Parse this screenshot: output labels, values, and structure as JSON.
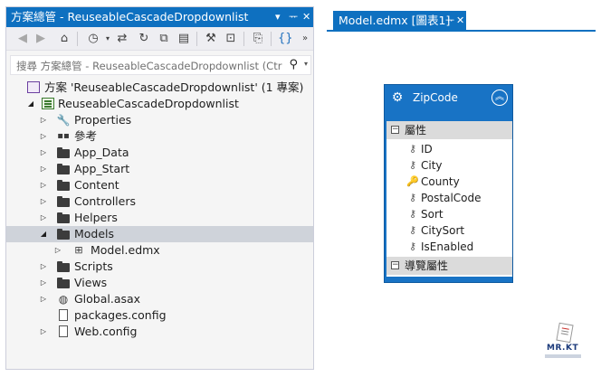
{
  "solution_explorer": {
    "title": "方案總管 - ReuseableCascadeDropdownlist",
    "controls": {
      "dropdown": "▾",
      "pin": "ᅲ",
      "close": "✕"
    },
    "search_placeholder": "搜尋 方案總管 - ReuseableCascadeDropdownlist (Ctr",
    "toolbar_icons": [
      "back-icon",
      "forward-icon",
      "home-icon",
      "history-icon",
      "sync-icon",
      "refresh-icon",
      "collapse-all-icon",
      "show-all-files-icon",
      "properties-icon",
      "preview-icon",
      "nest-files-icon",
      "code-view-icon"
    ],
    "tree": {
      "solution": "方案 'ReuseableCascadeDropdownlist' (1 專案)",
      "project": "ReuseableCascadeDropdownlist",
      "items": [
        {
          "label": "Properties",
          "icon": "wrench-icon"
        },
        {
          "label": "參考",
          "icon": "references-icon"
        },
        {
          "label": "App_Data",
          "icon": "folder-icon"
        },
        {
          "label": "App_Start",
          "icon": "folder-icon"
        },
        {
          "label": "Content",
          "icon": "folder-icon"
        },
        {
          "label": "Controllers",
          "icon": "folder-icon"
        },
        {
          "label": "Helpers",
          "icon": "folder-icon"
        },
        {
          "label": "Models",
          "icon": "folder-icon",
          "selected": true,
          "expanded": true
        },
        {
          "label": "Model.edmx",
          "icon": "edmx-file-icon"
        },
        {
          "label": "Scripts",
          "icon": "folder-icon"
        },
        {
          "label": "Views",
          "icon": "folder-icon"
        },
        {
          "label": "Global.asax",
          "icon": "global-asax-icon"
        },
        {
          "label": "packages.config",
          "icon": "config-file-icon"
        },
        {
          "label": "Web.config",
          "icon": "config-file-icon"
        }
      ]
    }
  },
  "document_tab": {
    "label": "Model.edmx [圖表1]",
    "pin": "ᅲ",
    "close": "✕"
  },
  "entity": {
    "name": "ZipCode",
    "properties_header": "屬性",
    "navigation_header": "導覽屬性",
    "section_toggle": "⊟",
    "properties": [
      {
        "name": "ID",
        "key": false
      },
      {
        "name": "City",
        "key": false
      },
      {
        "name": "County",
        "key": true
      },
      {
        "name": "PostalCode",
        "key": false
      },
      {
        "name": "Sort",
        "key": false
      },
      {
        "name": "CitySort",
        "key": false
      },
      {
        "name": "IsEnabled",
        "key": false
      }
    ],
    "colors": {
      "header": "#1873c5",
      "section": "#dbdbdb"
    }
  },
  "watermark": {
    "text": "MR.KT"
  },
  "colors": {
    "accent": "#0e70c0",
    "selection": "#cfd3da",
    "panel": "#f5f5f5"
  }
}
